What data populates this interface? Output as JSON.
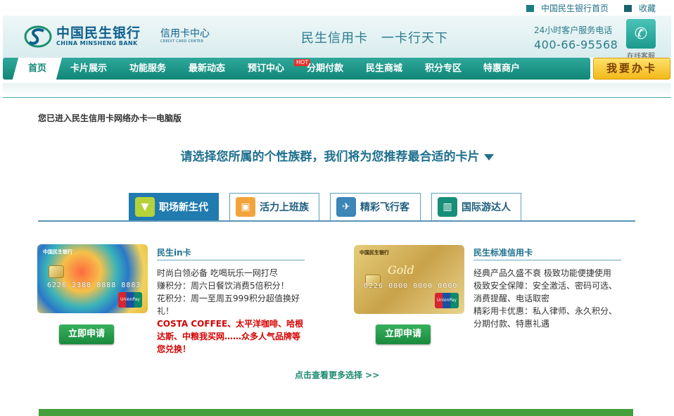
{
  "toplinks": {
    "home": "中国民生银行首页",
    "favorite": "收藏"
  },
  "header": {
    "logo_cn": "中国民生银行",
    "logo_en": "CHINA MINSHENG BANK",
    "cc_center_cn": "信用卡中心",
    "cc_center_en": "CREDIT CARD CENTER",
    "slogan": "民生信用卡　一卡行天下",
    "hotline_label": "24小时客户服务电话",
    "hotline_number": "400-66-95568",
    "online_service": "在线客服"
  },
  "nav": {
    "items": [
      "首页",
      "卡片展示",
      "功能服务",
      "最新动态",
      "预订中心",
      "分期付款",
      "民生商城",
      "积分专区",
      "特惠商户"
    ],
    "hot_badge": "HOT",
    "apply_card": "我要办卡"
  },
  "notice": "您已进入民生信用卡网络办卡一电脑版",
  "prompt": "请选择您所属的个性族群，我们将为您推荐最合适的卡片",
  "tabs": [
    {
      "label": "职场新生代",
      "active": true,
      "icon": "tie-icon"
    },
    {
      "label": "活力上班族",
      "active": false,
      "icon": "briefcase-icon"
    },
    {
      "label": "精彩飞行客",
      "active": false,
      "icon": "airplane-icon"
    },
    {
      "label": "国际游达人",
      "active": false,
      "icon": "luggage-icon"
    }
  ],
  "cards": [
    {
      "title": "民生in卡",
      "number": "6226 2388 8888 8883",
      "lines": [
        "时尚白领必备 吃喝玩乐一网打尽",
        "赚积分：周六日餐饮消费5倍积分！",
        "花积分：周一至周五999积分超值换好礼！"
      ],
      "highlight": "COSTA COFFEE、太平洋咖啡、哈根达斯、中粮我买网……众多人气品牌等您兑换！",
      "apply": "立即申请"
    },
    {
      "title": "民生标准信用卡",
      "number": "6226 0000 0000 0000",
      "card_word": "Gold",
      "lines": [
        "经典产品久盛不衰 极致功能便捷使用",
        "极致安全保障：安全激活、密码可选、消费提醒、电话取密",
        "精彩用卡优惠：私人律师、永久积分、分期付款、特惠礼遇"
      ],
      "apply": "立即申请"
    }
  ],
  "more_link": "点击查看更多选择 >>",
  "colors": {
    "nav_teal": "#0f8676",
    "brand_blue": "#0d5f8c",
    "apply_green": "#1a8a3d",
    "highlight_red": "#d40000"
  }
}
